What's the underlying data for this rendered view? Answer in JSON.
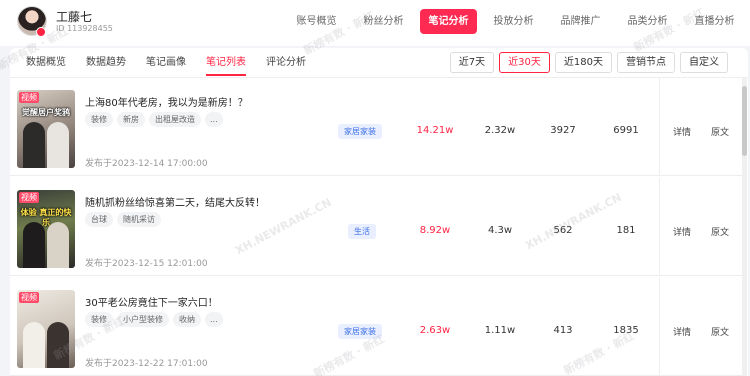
{
  "user": {
    "name": "工藤七",
    "id": "ID 113928455"
  },
  "nav": [
    {
      "label": "账号概览",
      "active": false
    },
    {
      "label": "粉丝分析",
      "active": false
    },
    {
      "label": "笔记分析",
      "active": true
    },
    {
      "label": "投放分析",
      "active": false
    },
    {
      "label": "品牌推广",
      "active": false
    },
    {
      "label": "品类分析",
      "active": false
    },
    {
      "label": "直播分析",
      "active": false
    }
  ],
  "subtabs": [
    {
      "label": "数据概览",
      "active": false
    },
    {
      "label": "数据趋势",
      "active": false
    },
    {
      "label": "笔记画像",
      "active": false
    },
    {
      "label": "笔记列表",
      "active": true
    },
    {
      "label": "评论分析",
      "active": false
    }
  ],
  "ranges": [
    {
      "label": "近7天",
      "active": false
    },
    {
      "label": "近30天",
      "active": true
    },
    {
      "label": "近180天",
      "active": false
    },
    {
      "label": "营销节点",
      "active": false
    },
    {
      "label": "自定义",
      "active": false
    }
  ],
  "notes": [
    {
      "badge": "视频",
      "thumb_caption": "觉醒居户奖鸦",
      "title": "上海80年代老房，我以为是新房！？",
      "tags": [
        "装修",
        "新房",
        "出租屋改造",
        "..."
      ],
      "published": "发布于2023-12-14 17:00:00",
      "category": "家居家装",
      "interactions": "14.21w",
      "likes": "2.32w",
      "comments": "3927",
      "shares": "6991"
    },
    {
      "badge": "视频",
      "thumb_caption": "体验 真正的快乐",
      "title": "随机抓粉丝给惊喜第二天，结尾大反转！",
      "tags": [
        "台球",
        "随机采访"
      ],
      "published": "发布于2023-12-15 12:01:00",
      "category": "生活",
      "interactions": "8.92w",
      "likes": "4.3w",
      "comments": "562",
      "shares": "181"
    },
    {
      "badge": "视频",
      "thumb_caption": "",
      "title": "30平老公房竟住下一家六口！",
      "tags": [
        "装修",
        "小户型装修",
        "收纳",
        "..."
      ],
      "published": "发布于2023-12-22 17:01:00",
      "category": "家居家装",
      "interactions": "2.63w",
      "likes": "1.11w",
      "comments": "413",
      "shares": "1835"
    }
  ],
  "actions": {
    "detail": "详情",
    "original": "原文"
  },
  "watermarks": [
    "新榜有数 · 新红",
    "XH.NEWRANK.CN"
  ]
}
